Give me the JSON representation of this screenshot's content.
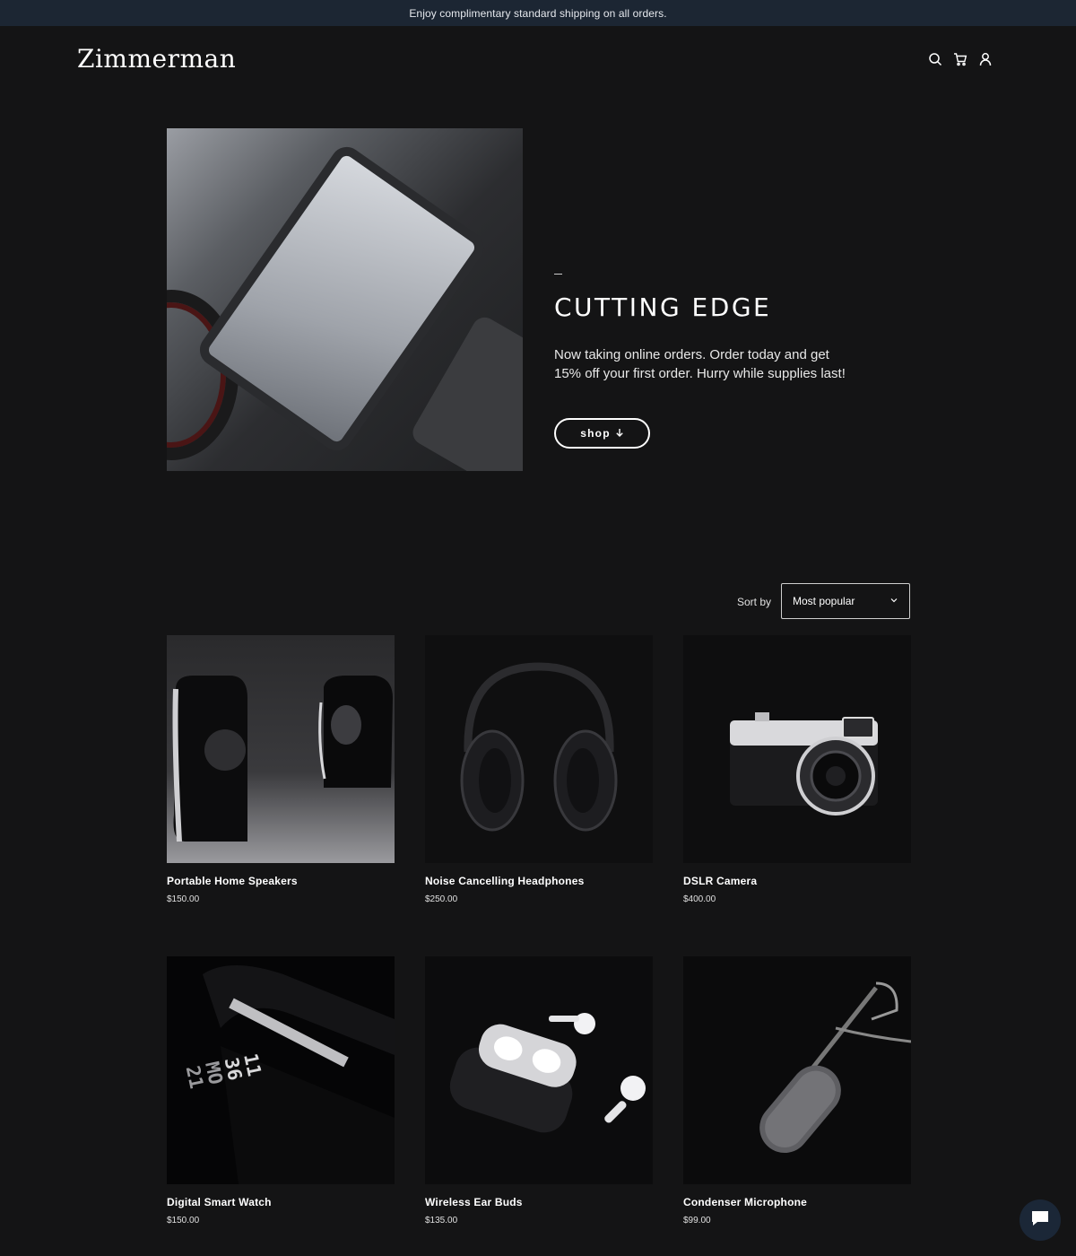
{
  "announcement": "Enjoy complimentary standard shipping on all orders.",
  "header": {
    "logo": "Zimmerman",
    "icons": [
      "search-icon",
      "cart-icon",
      "account-icon"
    ]
  },
  "hero": {
    "title": "CUTTING EDGE",
    "description": "Now taking online orders. Order today and get 15% off your first order. Hurry while supplies last!",
    "button_label": "shop",
    "button_icon": "arrow-down-icon"
  },
  "sort": {
    "label": "Sort by",
    "selected": "Most popular"
  },
  "products": [
    {
      "name": "Portable Home Speakers",
      "price": "$150.00"
    },
    {
      "name": "Noise Cancelling Headphones",
      "price": "$250.00"
    },
    {
      "name": "DSLR Camera",
      "price": "$400.00"
    },
    {
      "name": "Digital Smart Watch",
      "price": "$150.00"
    },
    {
      "name": "Wireless Ear Buds",
      "price": "$135.00"
    },
    {
      "name": "Condenser Microphone",
      "price": "$99.00"
    }
  ],
  "watch_face_text": [
    "11",
    "36",
    "MO",
    "21"
  ],
  "colors": {
    "background": "#141415",
    "announcement_bg": "#1c2633",
    "chat_button": "#1b2737"
  }
}
